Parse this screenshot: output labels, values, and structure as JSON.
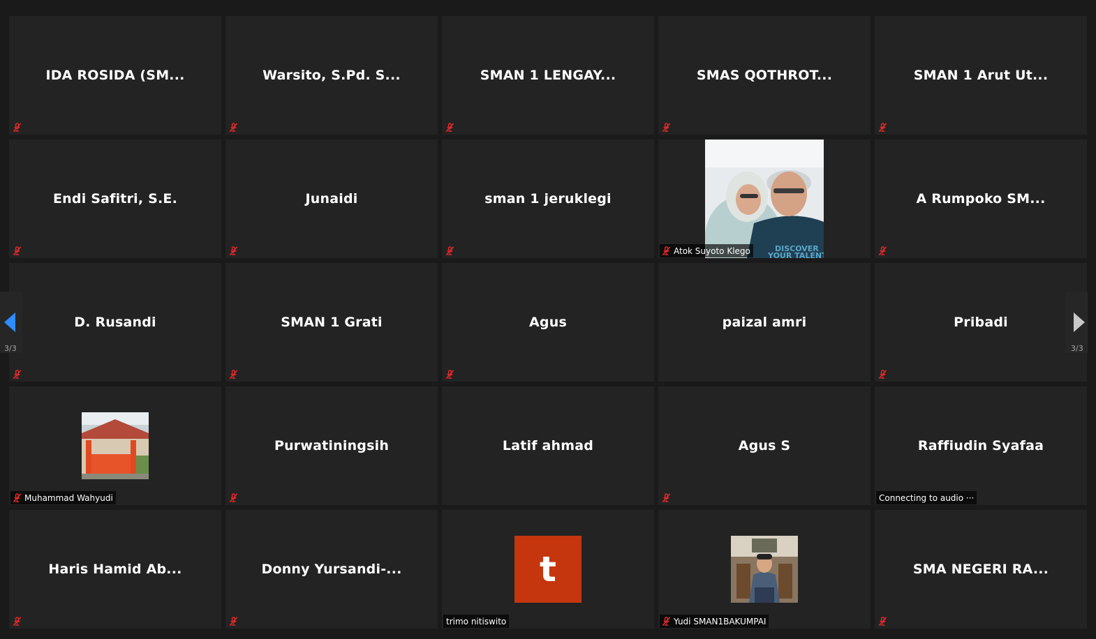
{
  "pager": {
    "left_label": "3/3",
    "right_label": "3/3"
  },
  "tiles": [
    {
      "name": "IDA ROSIDA (SM..."
    },
    {
      "name": "Warsito, S.Pd. S..."
    },
    {
      "name": "SMAN 1 LENGAY..."
    },
    {
      "name": "SMAS QOTHROT..."
    },
    {
      "name": "SMAN 1 Arut Ut..."
    },
    {
      "name": "Endi Safitri, S.E."
    },
    {
      "name": "Junaidi"
    },
    {
      "name": "sman 1 jeruklegi"
    },
    {
      "label": "Atok Suyoto Klego"
    },
    {
      "name": "A Rumpoko SM..."
    },
    {
      "name": "D. Rusandi"
    },
    {
      "name": "SMAN 1 Grati"
    },
    {
      "name": "Agus"
    },
    {
      "name": "paizal amri"
    },
    {
      "name": "Pribadi"
    },
    {
      "label": "Muhammad Wahyudi"
    },
    {
      "name": "Purwatiningsih"
    },
    {
      "name": "Latif ahmad"
    },
    {
      "name": "Agus S"
    },
    {
      "name": "Raffiudin Syafaa",
      "label": "Connecting to audio ···"
    },
    {
      "name": "Haris Hamid Ab..."
    },
    {
      "name": "Donny Yursandi-..."
    },
    {
      "avatar_letter": "t",
      "label": "trimo nitiswito"
    },
    {
      "label": "Yudi SMAN1BAKUMPAI"
    },
    {
      "name": "SMA NEGERI RA..."
    }
  ],
  "colors": {
    "background": "#1a1a1a",
    "tile": "#232323",
    "mute_icon": "#e02828",
    "avatar": "#c5360e",
    "nav_arrow_active": "#2d8cff",
    "nav_arrow_inactive": "#c8c8c8"
  },
  "icons": {
    "muted": "microphone-muted-icon",
    "prev": "arrow-left-icon",
    "next": "arrow-right-icon"
  }
}
